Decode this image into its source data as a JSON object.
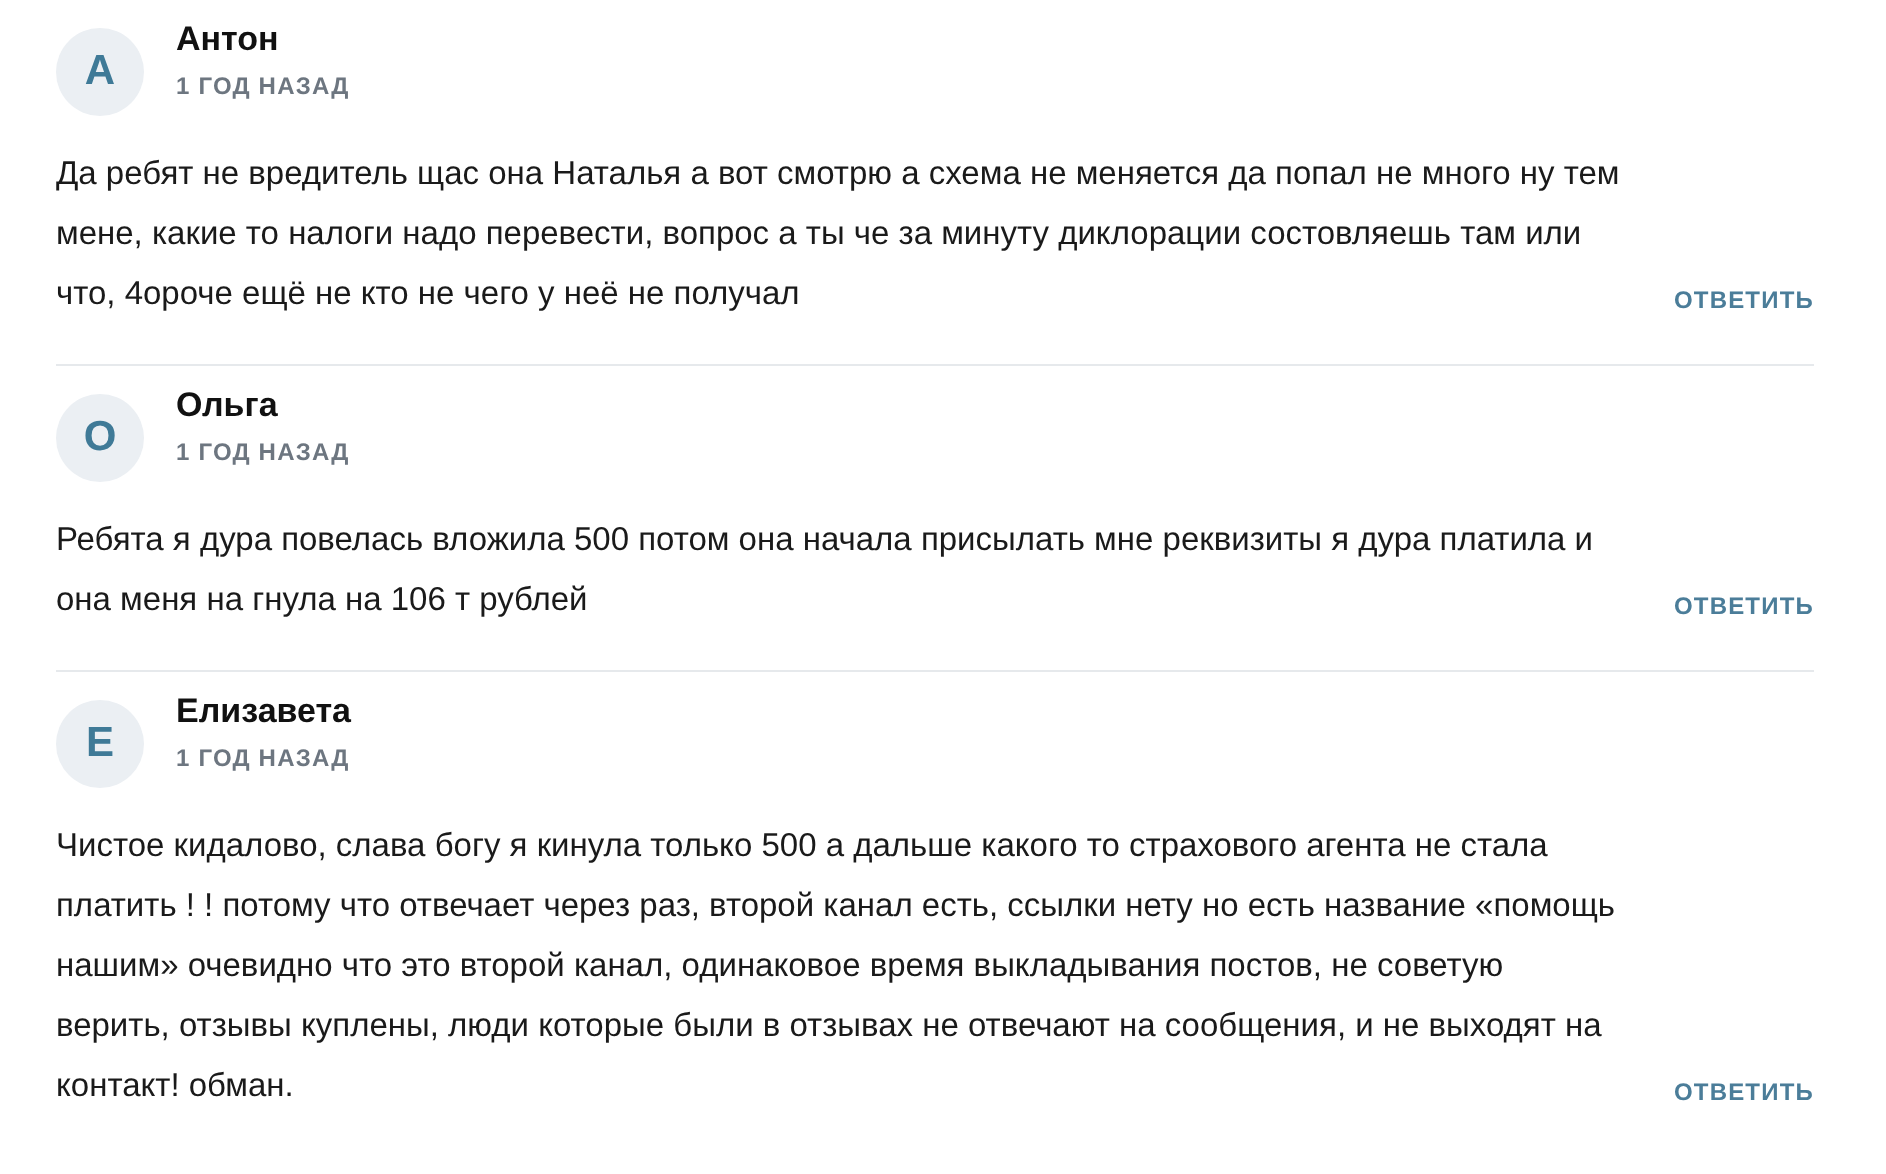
{
  "comments": [
    {
      "initial": "А",
      "author": "Антон",
      "time": "1 ГОД НАЗАД",
      "text": "Да ребят не вредитель щас она Наталья а вот смотрю а схема не меняется да попал не много ну тем мене, какие то налоги надо перевести, вопрос а ты че за минуту диклорации состовляешь там или что, 4ороче ещё не кто не чего у неё не получал",
      "reply": "ОТВЕТИТЬ"
    },
    {
      "initial": "О",
      "author": "Ольга",
      "time": "1 ГОД НАЗАД",
      "text": "Ребята я дура повелась вложила 500 потом она начала присылать мне реквизиты я дура платила и она меня на гнула на 106 т рублей",
      "reply": "ОТВЕТИТЬ"
    },
    {
      "initial": "Е",
      "author": "Елизавета",
      "time": "1 ГОД НАЗАД",
      "text": "Чистое кидалово, слава богу я кинула только 500 а дальше какого то страхового агента не стала платить ! ! потому что отвечает через раз, второй канал есть, ссылки нету но есть название «помощь нашим» очевидно что это второй канал, одинаковое время выкладывания постов, не советую верить, отзывы куплены, люди которые были в отзывах не отвечают на сообщения, и не выходят на контакт! обман.",
      "reply": "ОТВЕТИТЬ"
    }
  ]
}
